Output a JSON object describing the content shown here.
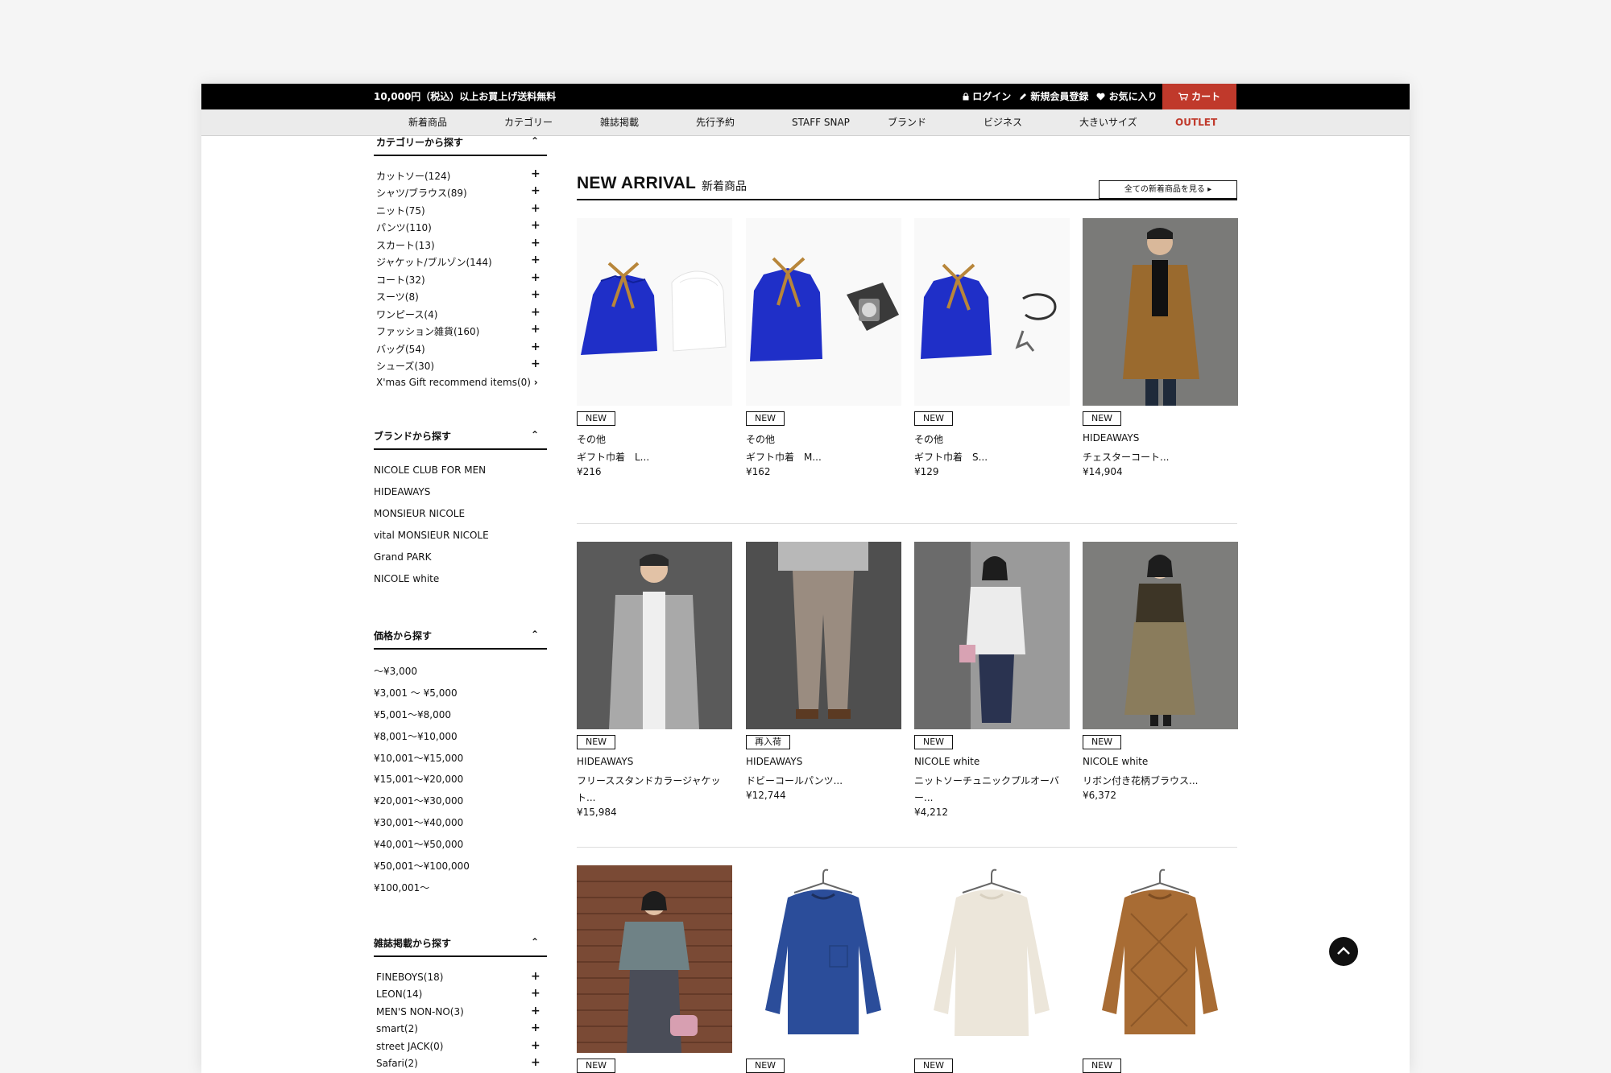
{
  "header": {
    "promo": "10,000円（税込）以上お買上げ送料無料",
    "login": "ログイン",
    "register": "新規会員登録",
    "favorites": "お気に入り",
    "cart": "カート"
  },
  "nav": [
    "新着商品",
    "カテゴリー",
    "雑誌掲載",
    "先行予約",
    "STAFF SNAP",
    "ブランド",
    "ビジネス",
    "大きいサイズ",
    "OUTLET"
  ],
  "sidebar": {
    "category_title": "カテゴリーから探す",
    "categories": [
      "カットソー(124)",
      "シャツ/ブラウス(89)",
      "ニット(75)",
      "パンツ(110)",
      "スカート(13)",
      "ジャケット/ブルゾン(144)",
      "コート(32)",
      "スーツ(8)",
      "ワンピース(4)",
      "ファッション雑貨(160)",
      "バッグ(54)",
      "シューズ(30)"
    ],
    "xmas_item": "X'mas Gift recommend items(0)",
    "brand_title": "ブランドから探す",
    "brands": [
      "NICOLE CLUB FOR MEN",
      "HIDEAWAYS",
      "MONSIEUR NICOLE",
      "vital MONSIEUR NICOLE",
      "Grand PARK",
      "NICOLE white"
    ],
    "price_title": "価格から探す",
    "prices": [
      "〜¥3,000",
      "¥3,001 〜 ¥5,000",
      "¥5,001〜¥8,000",
      "¥8,001〜¥10,000",
      "¥10,001〜¥15,000",
      "¥15,001〜¥20,000",
      "¥20,001〜¥30,000",
      "¥30,001〜¥40,000",
      "¥40,001〜¥50,000",
      "¥50,001〜¥100,000",
      "¥100,001〜"
    ],
    "magazine_title": "雑誌掲載から探す",
    "magazines": [
      "FINEBOYS(18)",
      "LEON(14)",
      "MEN'S NON-NO(3)",
      "smart(2)",
      "street JACK(0)",
      "Safari(2)"
    ]
  },
  "main": {
    "title": "NEW ARRIVAL",
    "subtitle": "新着商品",
    "see_all": "全ての新着商品を見る"
  },
  "products": [
    {
      "badge": "NEW",
      "brand": "その他",
      "name": "ギフト巾着　L...",
      "price": "¥216"
    },
    {
      "badge": "NEW",
      "brand": "その他",
      "name": "ギフト巾着　M...",
      "price": "¥162"
    },
    {
      "badge": "NEW",
      "brand": "その他",
      "name": "ギフト巾着　S...",
      "price": "¥129"
    },
    {
      "badge": "NEW",
      "brand": "HIDEAWAYS",
      "name": "チェスターコート...",
      "price": "¥14,904"
    },
    {
      "badge": "NEW",
      "brand": "HIDEAWAYS",
      "name": "フリーススタンドカラージャケット...",
      "price": "¥15,984"
    },
    {
      "badge": "再入荷",
      "brand": "HIDEAWAYS",
      "name": "ドビーコールパンツ...",
      "price": "¥12,744"
    },
    {
      "badge": "NEW",
      "brand": "NICOLE white",
      "name": "ニットソーチュニックプルオーバー...",
      "price": "¥4,212"
    },
    {
      "badge": "NEW",
      "brand": "NICOLE white",
      "name": "リボン付き花柄ブラウス...",
      "price": "¥6,372"
    },
    {
      "badge": "NEW"
    },
    {
      "badge": "NEW"
    },
    {
      "badge": "NEW"
    },
    {
      "badge": "NEW"
    }
  ],
  "colors": {
    "cart": "#c0392b",
    "outlet": "#c0392b",
    "gift_bag": "#1f2fc8",
    "ribbon": "#b8863a"
  }
}
